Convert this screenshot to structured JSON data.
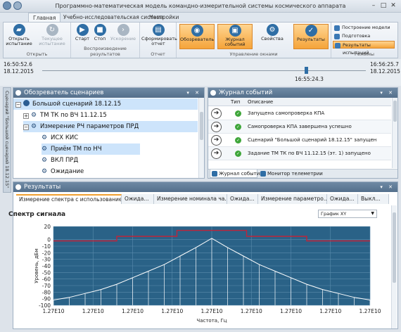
{
  "window": {
    "title": "Программно-математическая модель командно-измерительной системы космического аппарата",
    "minimize": "–",
    "maximize": "□",
    "close": "✕"
  },
  "ribbon_tabs": [
    "Главная",
    "Учебно-исследовательская система",
    "Настройки"
  ],
  "ribbon": {
    "groups": {
      "open": "Открыть",
      "playback": "Воспроизведение результатов",
      "report": "Отчет",
      "windows": "Управление окнами",
      "modes": "Режимы"
    },
    "open_test": "Открыть испытание",
    "current_test": "Текущее испытание",
    "start": "Старт",
    "stop": "Стоп",
    "speedup": "Ускорение",
    "make_report": "Сформировать отчет",
    "observer": "Обозреватель",
    "event_log": "Журнал событий",
    "properties": "Свойства",
    "results": "Результаты",
    "mode_build": "Построение модели",
    "mode_prepare": "Подготовка испытаний",
    "mode_results": "Результаты испытаний"
  },
  "timeline": {
    "start_time": "16:50:52.6",
    "start_date": "18.12.2015",
    "end_time": "16:56:25.7",
    "end_date": "18.12.2015",
    "current_time": "16:55:24.3",
    "position_fraction": 0.815
  },
  "side_tab": "Сценарий \"Большой сценарий 18.12.15\"",
  "scenario_panel": {
    "title": "Обозреватель сценариев",
    "items": [
      {
        "label": "Большой сценарий 18.12.15"
      },
      {
        "label": "ТМ ТК по ВЧ 11.12.15"
      },
      {
        "label": "Измерение РЧ параметров ПРД"
      },
      {
        "label": "ИСХ КИС"
      },
      {
        "label": "Приём ТМ по НЧ"
      },
      {
        "label": "ВКЛ ПРД"
      },
      {
        "label": "Ожидание"
      }
    ]
  },
  "events_panel": {
    "title": "Журнал событий",
    "col_type": "Тип",
    "col_desc": "Описание",
    "rows": [
      "Запущена самопроверка КПА",
      "Самопроверка КПА завершена успешно",
      "Сценарий \"Большой сценарий 18.12.15\" запущен",
      "Задание ТМ ТК по ВЧ 11.12.15 (эт. 1) запущено"
    ],
    "bottom_tabs": [
      "Журнал событий",
      "Монитор телеметрии"
    ]
  },
  "results_panel": {
    "title": "Результаты",
    "tabs": [
      "Измерение спектра с использование...",
      "Ожида...",
      "Измерение номинала ча...",
      "Ожида...",
      "Измерение параметро...",
      "Ожида...",
      "Выкл..."
    ],
    "chart_title": "Спектр сигнала",
    "chart_type_select": "График XY"
  },
  "chart_data": {
    "type": "line",
    "title": "Спектр сигнала",
    "xlabel": "Частота, Гц",
    "ylabel": "Уровень, дБм",
    "ylim": [
      -100,
      20
    ],
    "yticks": [
      20,
      0,
      -10,
      -20,
      -30,
      -40,
      -50,
      -60,
      -70,
      -80,
      -90,
      -100
    ],
    "ytick_labels": [
      "20",
      "0",
      "-10",
      "-20",
      "-30",
      "-40",
      "-50",
      "-60",
      "-70",
      "-80",
      "-90",
      "-100"
    ],
    "xtick_labels": [
      "1.27E10",
      "1.27E10",
      "1.27E10",
      "1.27E10",
      "1.27E10",
      "1.27E10",
      "1.27E10",
      "1.27E10",
      "1.27E10"
    ],
    "grid": true,
    "series": [
      {
        "role": "mask",
        "color": "#c0243a",
        "x": [
          0,
          0.2,
          0.2,
          0.39,
          0.39,
          0.61,
          0.61,
          0.8,
          0.8,
          1.0
        ],
        "values": [
          -2,
          -2,
          5,
          5,
          14,
          14,
          5,
          5,
          -2,
          -2
        ]
      },
      {
        "role": "spectrum",
        "color": "#ffffff",
        "x": [
          0.0,
          0.05,
          0.1,
          0.15,
          0.2,
          0.25,
          0.3,
          0.35,
          0.4,
          0.45,
          0.5,
          0.55,
          0.6,
          0.65,
          0.7,
          0.75,
          0.8,
          0.85,
          0.9,
          0.95,
          1.0
        ],
        "values": [
          -92,
          -88,
          -82,
          -76,
          -68,
          -58,
          -48,
          -38,
          -25,
          -12,
          2,
          -12,
          -25,
          -38,
          -48,
          -58,
          -68,
          -76,
          -82,
          -88,
          -92
        ]
      }
    ]
  },
  "colors": {
    "plot_bg": "#2a6287",
    "accent": "#2f6ea5",
    "selected_orange": "#f5a43a",
    "mask_red": "#c0243a"
  }
}
